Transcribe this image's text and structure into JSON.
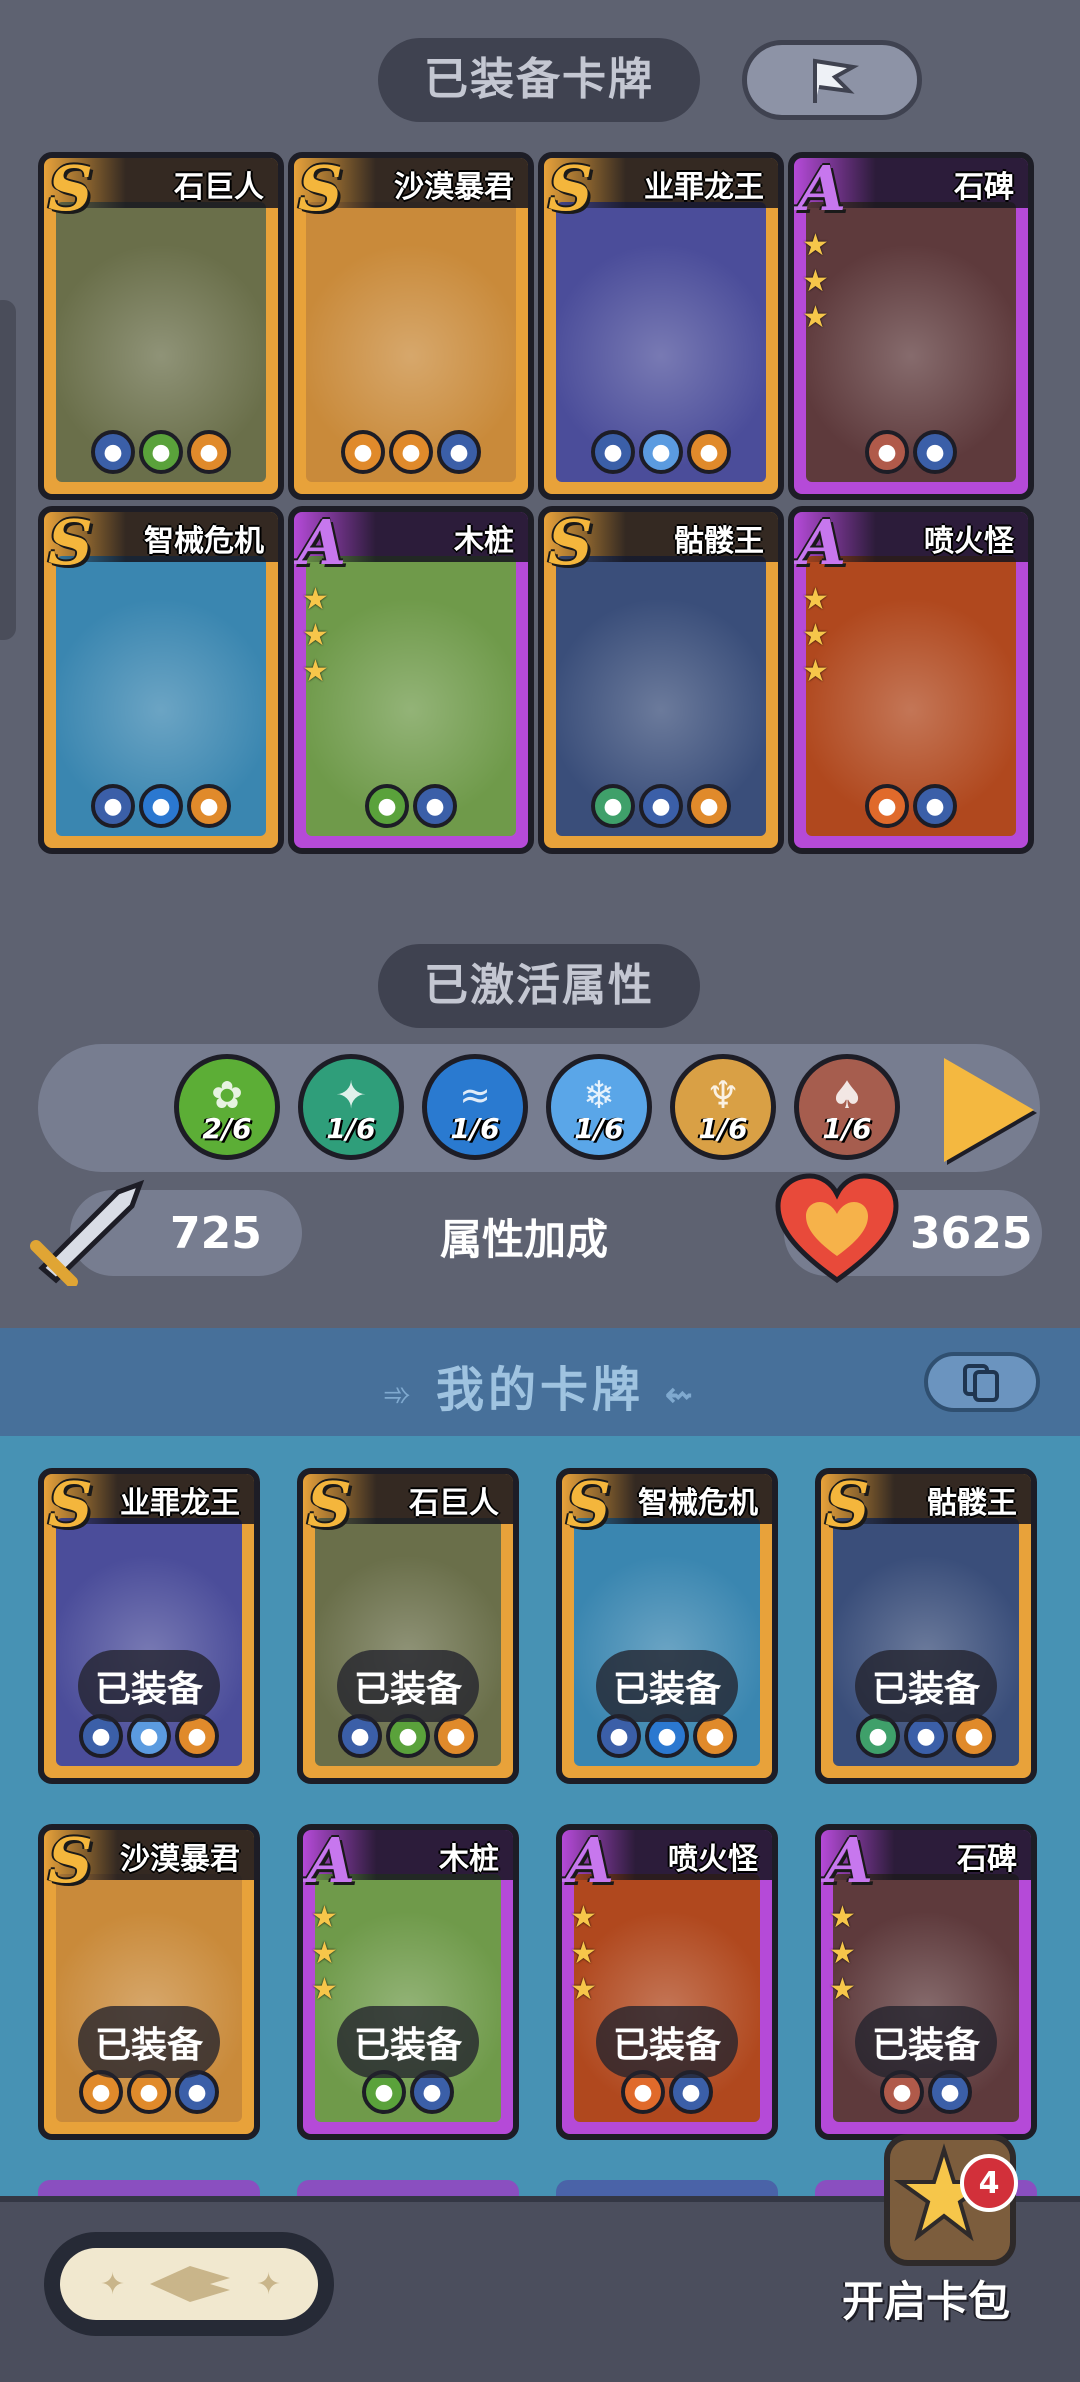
{
  "equipped_section": {
    "title": "已装备卡牌"
  },
  "equipped_cards": [
    {
      "rank": "S",
      "name": "石巨人",
      "art_color": "#6a6f4a",
      "icon_colors": [
        "#3b5fa8",
        "#5aa23b",
        "#e08a2b"
      ]
    },
    {
      "rank": "S",
      "name": "沙漠暴君",
      "art_color": "#c98a3a",
      "icon_colors": [
        "#e08a2b",
        "#e08a2b",
        "#3b5fa8"
      ]
    },
    {
      "rank": "S",
      "name": "业罪龙王",
      "art_color": "#4b4d9a",
      "icon_colors": [
        "#3b5fa8",
        "#5b9be0",
        "#e08a2b"
      ]
    },
    {
      "rank": "A",
      "name": "石碑",
      "art_color": "#5e3a3c",
      "icon_colors": [
        "#b05a4a",
        "#3b5fa8"
      ],
      "stars": 3
    },
    {
      "rank": "S",
      "name": "智械危机",
      "art_color": "#3a86b0",
      "icon_colors": [
        "#3b5fa8",
        "#2b78d0",
        "#e08a2b"
      ]
    },
    {
      "rank": "A",
      "name": "木桩",
      "art_color": "#6f9a4a",
      "icon_colors": [
        "#5aa23b",
        "#3b5fa8"
      ],
      "stars": 3
    },
    {
      "rank": "S",
      "name": "骷髅王",
      "art_color": "#3a4e7a",
      "icon_colors": [
        "#3fa06a",
        "#3b5fa8",
        "#e08a2b"
      ]
    },
    {
      "rank": "A",
      "name": "喷火怪",
      "art_color": "#b0481e",
      "icon_colors": [
        "#e06a2b",
        "#3b5fa8"
      ],
      "stars": 3
    }
  ],
  "attributes_section": {
    "title": "已激活属性"
  },
  "attributes": [
    {
      "name": "grass-attribute-icon",
      "count": "2/6",
      "color": "#5cae36",
      "glyph": "✿"
    },
    {
      "name": "thorn-attribute-icon",
      "count": "1/6",
      "color": "#2f9e7a",
      "glyph": "✦"
    },
    {
      "name": "wave-attribute-icon",
      "count": "1/6",
      "color": "#2a7ad0",
      "glyph": "≈"
    },
    {
      "name": "ice-attribute-icon",
      "count": "1/6",
      "color": "#5aa6e8",
      "glyph": "❄"
    },
    {
      "name": "cactus-attribute-icon",
      "count": "1/6",
      "color": "#d9a045",
      "glyph": "♆"
    },
    {
      "name": "squid-attribute-icon",
      "count": "1/6",
      "color": "#a65d4e",
      "glyph": "♠"
    }
  ],
  "stats": {
    "attack": "725",
    "label": "属性加成",
    "health": "3625"
  },
  "my_cards_section": {
    "title": "我的卡牌"
  },
  "my_cards": [
    {
      "rank": "S",
      "name": "业罪龙王",
      "art_color": "#4b4d9a",
      "status": "已装备",
      "icon_colors": [
        "#3b5fa8",
        "#5b9be0",
        "#e08a2b"
      ]
    },
    {
      "rank": "S",
      "name": "石巨人",
      "art_color": "#6a6f4a",
      "status": "已装备",
      "icon_colors": [
        "#3b5fa8",
        "#5aa23b",
        "#e08a2b"
      ]
    },
    {
      "rank": "S",
      "name": "智械危机",
      "art_color": "#3a86b0",
      "status": "已装备",
      "icon_colors": [
        "#3b5fa8",
        "#2b78d0",
        "#e08a2b"
      ]
    },
    {
      "rank": "S",
      "name": "骷髅王",
      "art_color": "#3a4e7a",
      "status": "已装备",
      "icon_colors": [
        "#3fa06a",
        "#3b5fa8",
        "#e08a2b"
      ]
    },
    {
      "rank": "S",
      "name": "沙漠暴君",
      "art_color": "#c98a3a",
      "status": "已装备",
      "icon_colors": [
        "#e08a2b",
        "#e08a2b",
        "#3b5fa8"
      ]
    },
    {
      "rank": "A",
      "name": "木桩",
      "art_color": "#6f9a4a",
      "status": "已装备",
      "icon_colors": [
        "#5aa23b",
        "#3b5fa8"
      ],
      "stars": 3
    },
    {
      "rank": "A",
      "name": "喷火怪",
      "art_color": "#b0481e",
      "status": "已装备",
      "icon_colors": [
        "#e06a2b",
        "#3b5fa8"
      ],
      "stars": 3
    },
    {
      "rank": "A",
      "name": "石碑",
      "art_color": "#5e3a3c",
      "status": "已装备",
      "icon_colors": [
        "#b05a4a",
        "#3b5fa8"
      ],
      "stars": 3
    }
  ],
  "open_pack": {
    "label": "开启卡包",
    "badge_count": "4"
  }
}
